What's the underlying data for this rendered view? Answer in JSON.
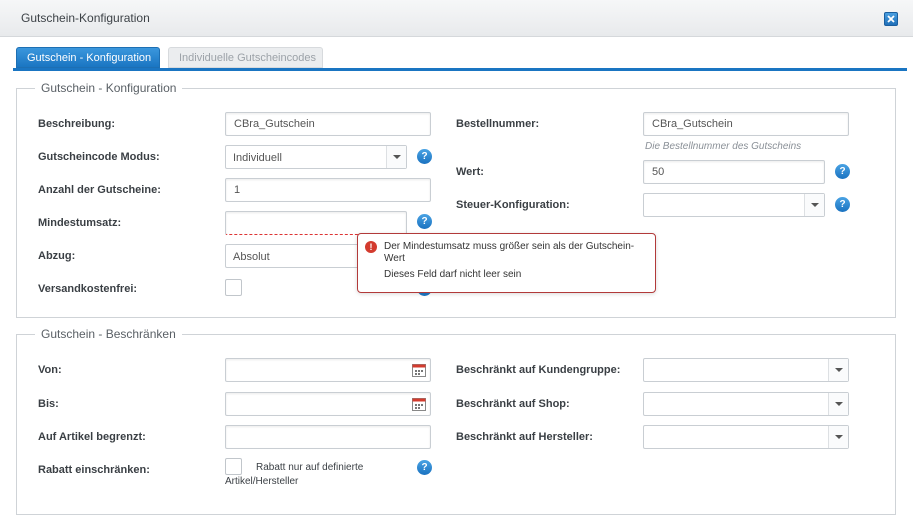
{
  "window": {
    "title": "Gutschein-Konfiguration"
  },
  "tabs": [
    {
      "label": "Gutschein - Konfiguration",
      "active": true
    },
    {
      "label": "Individuelle Gutscheincodes",
      "active": false
    }
  ],
  "config": {
    "legend": "Gutschein - Konfiguration",
    "beschreibung": {
      "label": "Beschreibung:",
      "value": "CBra_Gutschein"
    },
    "modus": {
      "label": "Gutscheincode Modus:",
      "value": "Individuell"
    },
    "anzahl": {
      "label": "Anzahl der Gutscheine:",
      "value": "1"
    },
    "mindestumsatz": {
      "label": "Mindestumsatz:",
      "value": ""
    },
    "abzug": {
      "label": "Abzug:",
      "value": "Absolut"
    },
    "versand": {
      "label": "Versandkostenfrei:"
    },
    "bestellnummer": {
      "label": "Bestellnummer:",
      "value": "CBra_Gutschein",
      "hint": "Die Bestellnummer des Gutscheins"
    },
    "wert": {
      "label": "Wert:",
      "value": "50"
    },
    "steuer": {
      "label": "Steuer-Konfiguration:",
      "value": ""
    }
  },
  "error_tooltip": {
    "line1": "Der Mindestumsatz muss größer sein als der Gutschein-Wert",
    "line2": "Dieses Feld darf nicht leer sein"
  },
  "restrict": {
    "legend": "Gutschein - Beschränken",
    "von": {
      "label": "Von:",
      "value": ""
    },
    "bis": {
      "label": "Bis:",
      "value": ""
    },
    "artikel": {
      "label": "Auf Artikel begrenzt:",
      "value": ""
    },
    "rabatt": {
      "label": "Rabatt einschränken:",
      "checkbox_label_1": "Rabatt nur auf definierte",
      "checkbox_label_2": "Artikel/Hersteller"
    },
    "kundengruppe": {
      "label": "Beschränkt auf Kundengruppe:",
      "value": ""
    },
    "shop": {
      "label": "Beschränkt auf Shop:",
      "value": ""
    },
    "hersteller": {
      "label": "Beschränkt auf Hersteller:",
      "value": ""
    }
  },
  "icons": {
    "help": "?",
    "error": "!",
    "close": "close-icon",
    "calendar": "calendar-icon"
  },
  "colors": {
    "accent": "#1a75c2",
    "error": "#b23a3a"
  }
}
